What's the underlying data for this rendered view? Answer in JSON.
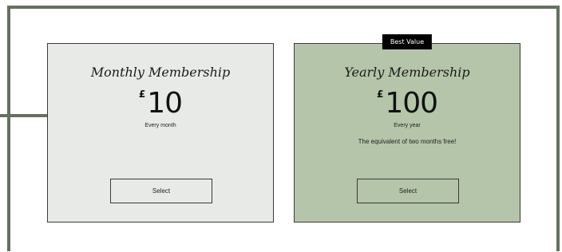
{
  "colors": {
    "frame": "#65705f",
    "monthly_card_bg": "#e7eae6",
    "yearly_card_bg": "#b4c5a9",
    "badge_bg": "#000000"
  },
  "plans": {
    "monthly": {
      "title": "Monthly Membership",
      "currency": "£",
      "amount": "10",
      "period": "Every month",
      "select_label": "Select"
    },
    "yearly": {
      "badge": "Best Value",
      "title": "Yearly Membership",
      "currency": "£",
      "amount": "100",
      "period": "Every year",
      "note": "The equivalent of two months free!",
      "select_label": "Select"
    }
  }
}
